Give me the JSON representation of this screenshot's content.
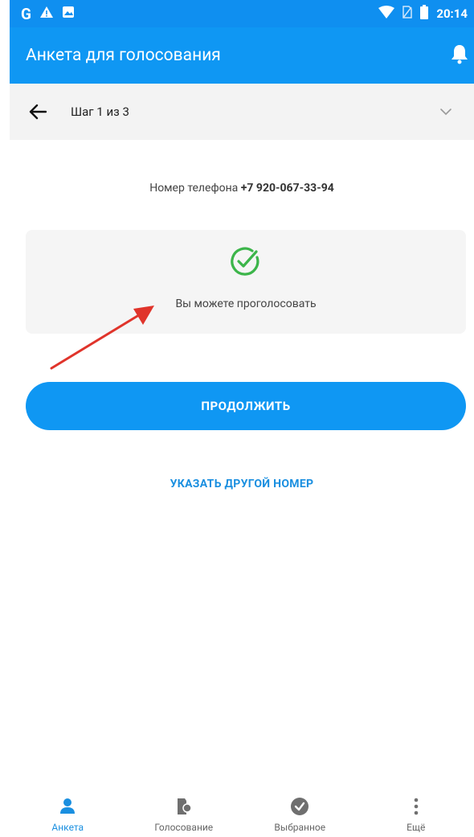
{
  "status_bar": {
    "time": "20:14",
    "icons": [
      "google-icon",
      "warning-icon",
      "image-icon",
      "wifi-icon",
      "no-sim-icon",
      "battery-icon"
    ]
  },
  "app_bar": {
    "title": "Анкета для голосования",
    "icon": "bell-icon"
  },
  "step_bar": {
    "label": "Шаг 1 из 3",
    "icons": [
      "back-arrow-icon",
      "chevron-down-icon"
    ]
  },
  "phone": {
    "prefix": "Номер телефона",
    "number": "+7 920-067-33-94"
  },
  "status_card": {
    "text": "Вы можете проголосовать",
    "icon": "check-circle-icon",
    "accent": "#3cb54a"
  },
  "actions": {
    "continue_label": "ПРОДОЛЖИТЬ",
    "other_number_label": "УКАЗАТЬ ДРУГОЙ НОМЕР"
  },
  "bottom_nav": {
    "items": [
      {
        "label": "Анкета",
        "icon": "person-icon",
        "active": true
      },
      {
        "label": "Голосование",
        "icon": "ballot-icon",
        "active": false
      },
      {
        "label": "Выбранное",
        "icon": "check-badge-icon",
        "active": false
      },
      {
        "label": "Ещё",
        "icon": "more-vertical-icon",
        "active": false
      }
    ]
  },
  "colors": {
    "primary": "#0f97f3",
    "link": "#1a8fe0",
    "annotation": "#e0342b"
  }
}
